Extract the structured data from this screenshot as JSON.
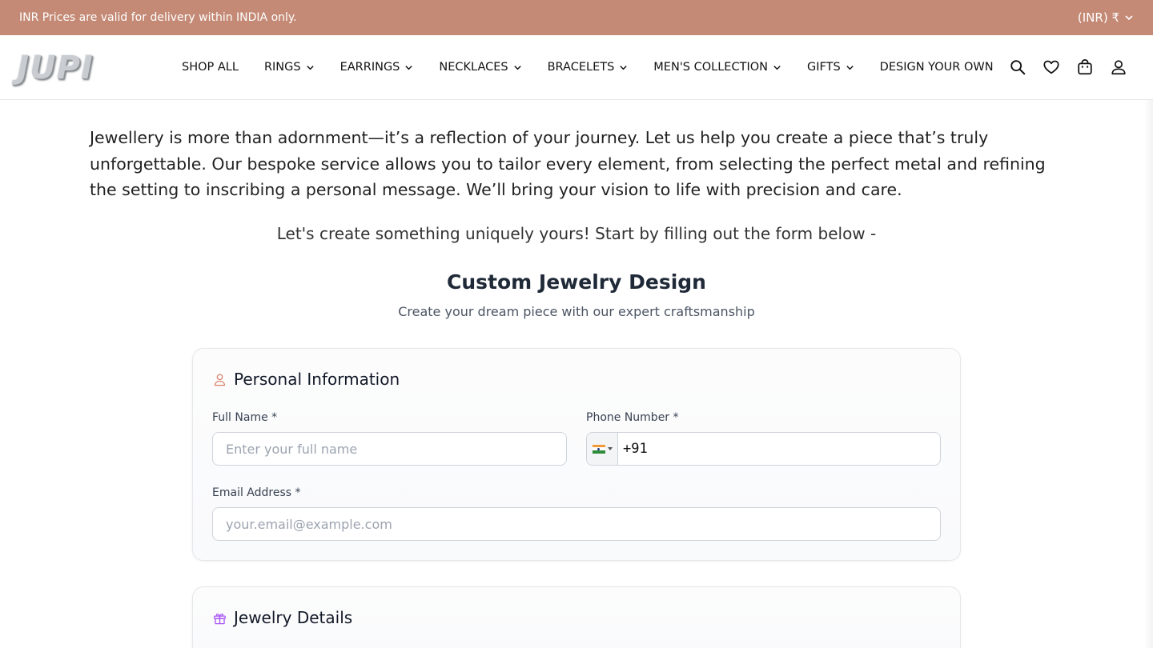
{
  "topbar": {
    "notice": "INR Prices are valid for delivery within INDIA only.",
    "currency": "(INR) ₹"
  },
  "brand": {
    "logo_text": "JUPI"
  },
  "nav": {
    "items": [
      {
        "label": "SHOP ALL",
        "has_dropdown": false
      },
      {
        "label": "RINGS",
        "has_dropdown": true
      },
      {
        "label": "EARRINGS",
        "has_dropdown": true
      },
      {
        "label": "NECKLACES",
        "has_dropdown": true
      },
      {
        "label": "BRACELETS",
        "has_dropdown": true
      },
      {
        "label": "MEN'S COLLECTION",
        "has_dropdown": true
      },
      {
        "label": "GIFTS",
        "has_dropdown": true
      },
      {
        "label": "DESIGN YOUR OWN",
        "has_dropdown": false
      }
    ],
    "icons": [
      "search-icon",
      "heart-icon",
      "shopping-bag-icon",
      "user-icon"
    ]
  },
  "intro": {
    "paragraph": "Jewellery is more than adornment—it’s a reflection of your journey. Let us help you create a piece that’s truly unforgettable. Our bespoke service allows you to tailor every element, from selecting the perfect metal and refining the setting to inscribing a personal message. We’ll bring your vision to life with precision and care.",
    "cta": "Let's create something uniquely yours! Start by filling out the form below -"
  },
  "form": {
    "title": "Custom Jewelry Design",
    "subtitle": "Create your dream piece with our expert craftsmanship",
    "personal": {
      "heading": "Personal Information",
      "full_name_label": "Full Name *",
      "full_name_placeholder": "Enter your full name",
      "phone_label": "Phone Number *",
      "phone_value": "+91",
      "email_label": "Email Address *",
      "email_placeholder": "your.email@example.com"
    },
    "jewelry": {
      "heading": "Jewelry Details"
    }
  },
  "colors": {
    "topbar_bg": "#c48a76",
    "accent_user_icon": "#d9826a",
    "accent_gift_icon": "#a855f7"
  }
}
